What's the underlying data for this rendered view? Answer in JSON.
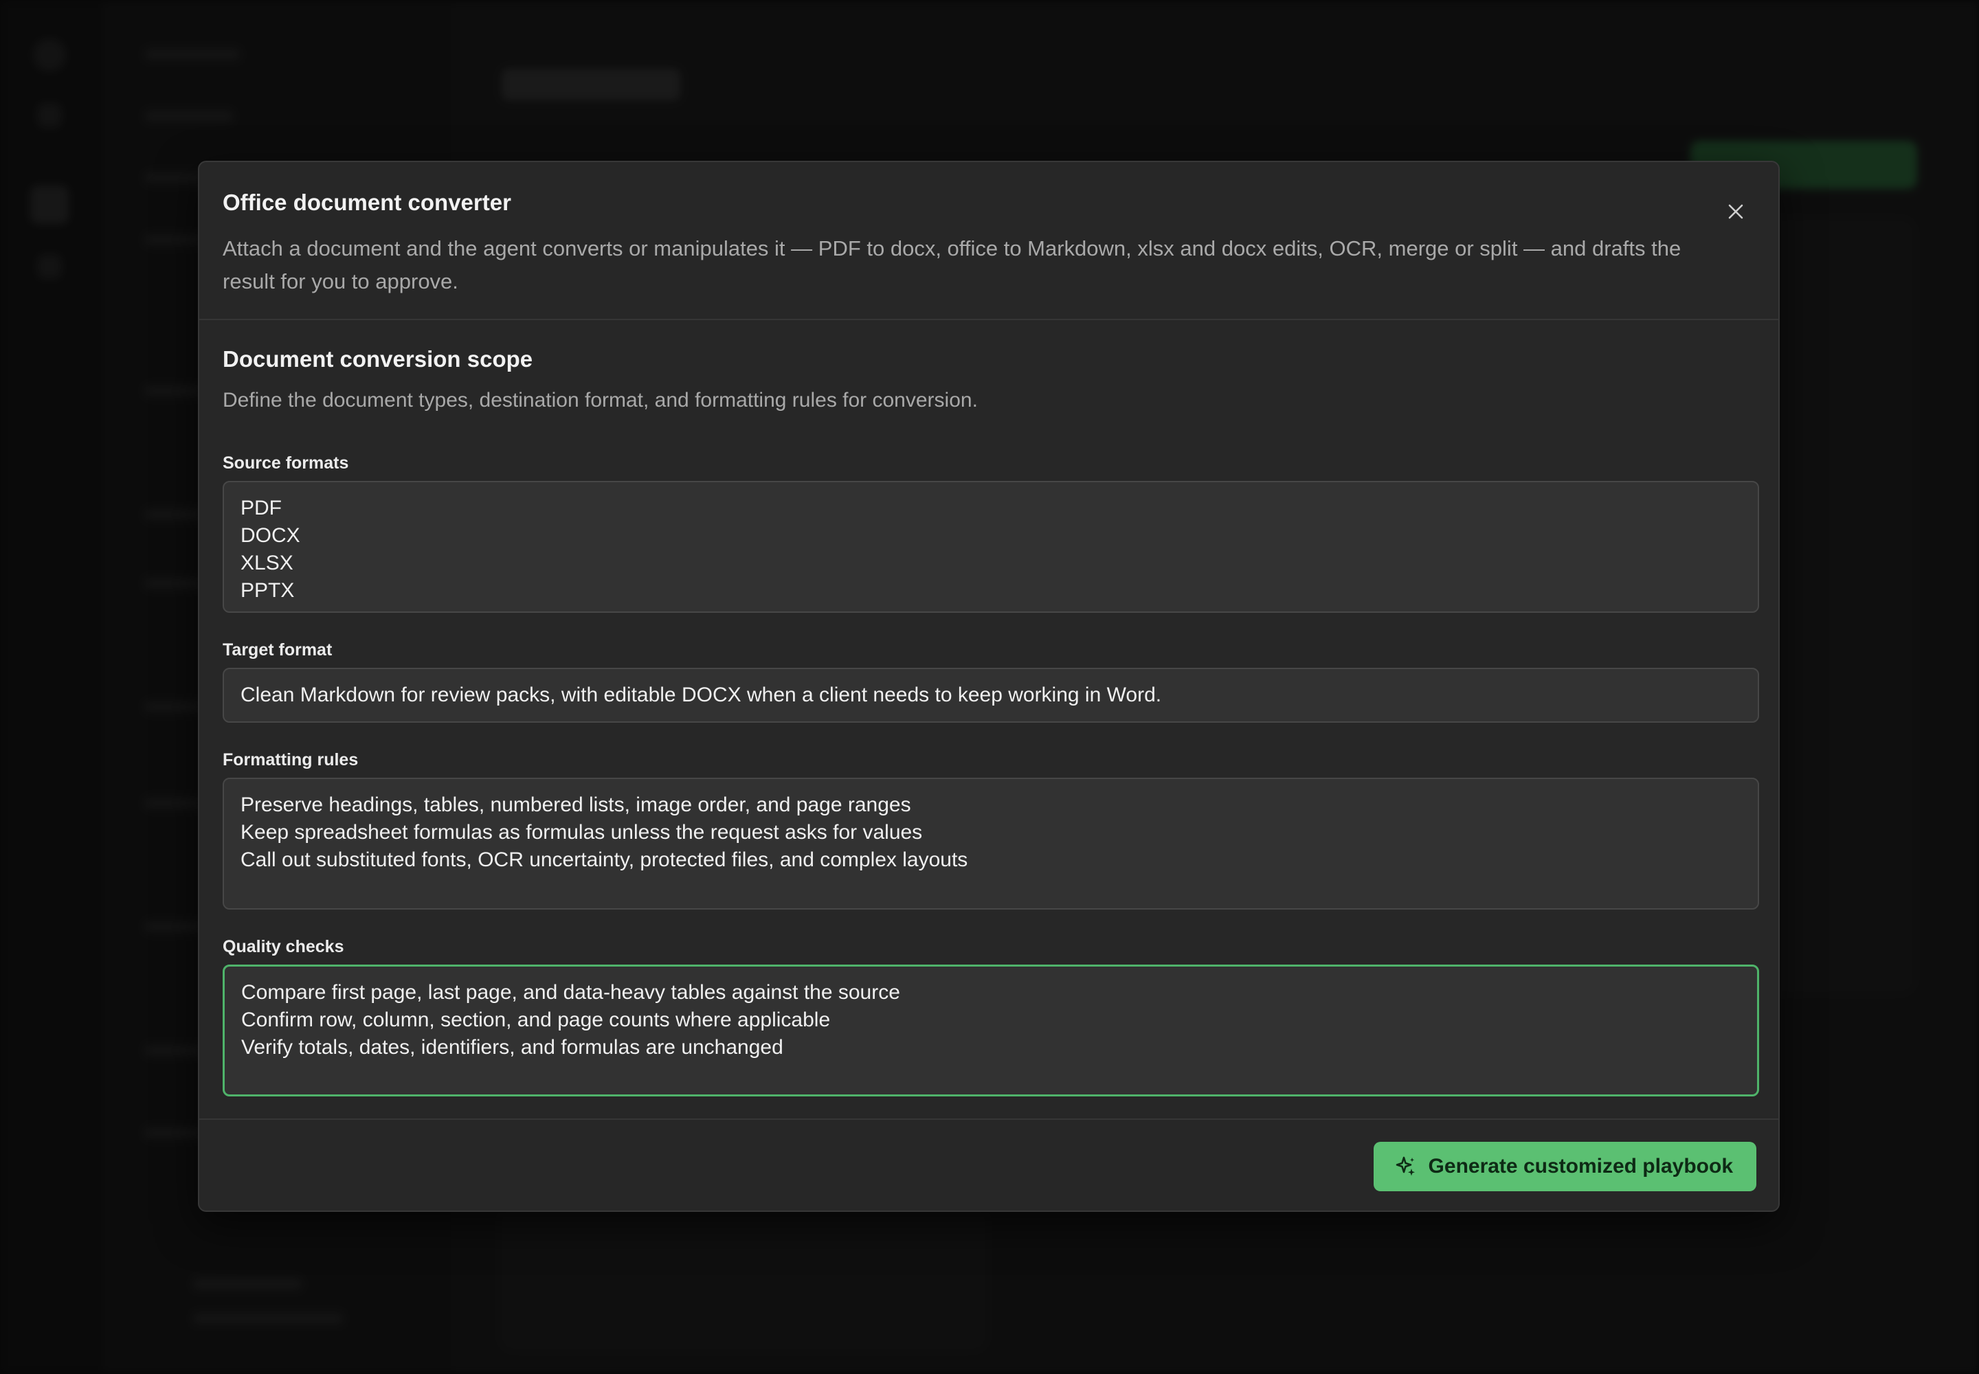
{
  "modal": {
    "title": "Office document converter",
    "description": "Attach a document and the agent converts or manipulates it — PDF to docx, office to Markdown, xlsx and docx edits, OCR, merge or split — and drafts the result for you to approve.",
    "close_icon": "close-icon"
  },
  "section": {
    "title": "Document conversion scope",
    "description": "Define the document types, destination format, and formatting rules for conversion."
  },
  "fields": {
    "source_formats": {
      "label": "Source formats",
      "lines": [
        "PDF",
        "DOCX",
        "XLSX",
        "PPTX"
      ]
    },
    "target_format": {
      "label": "Target format",
      "value": "Clean Markdown for review packs, with editable DOCX when a client needs to keep working in Word."
    },
    "formatting_rules": {
      "label": "Formatting rules",
      "lines": [
        "Preserve headings, tables, numbered lists, image order, and page ranges",
        "Keep spreadsheet formulas as formulas unless the request asks for values",
        "Call out substituted fonts, OCR uncertainty, protected files, and complex layouts"
      ]
    },
    "quality_checks": {
      "label": "Quality checks",
      "lines": [
        "Compare first page, last page, and data-heavy tables against the source",
        "Confirm row, column, section, and page counts where applicable",
        "Verify totals, dates, identifiers, and formulas are unchanged"
      ]
    }
  },
  "footer": {
    "generate_label": "Generate customized playbook",
    "generate_icon": "sparkle-icon"
  },
  "colors": {
    "accent": "#5bc072",
    "focus_border": "#4fb36a",
    "modal_bg": "#272727",
    "field_bg": "#323232"
  }
}
